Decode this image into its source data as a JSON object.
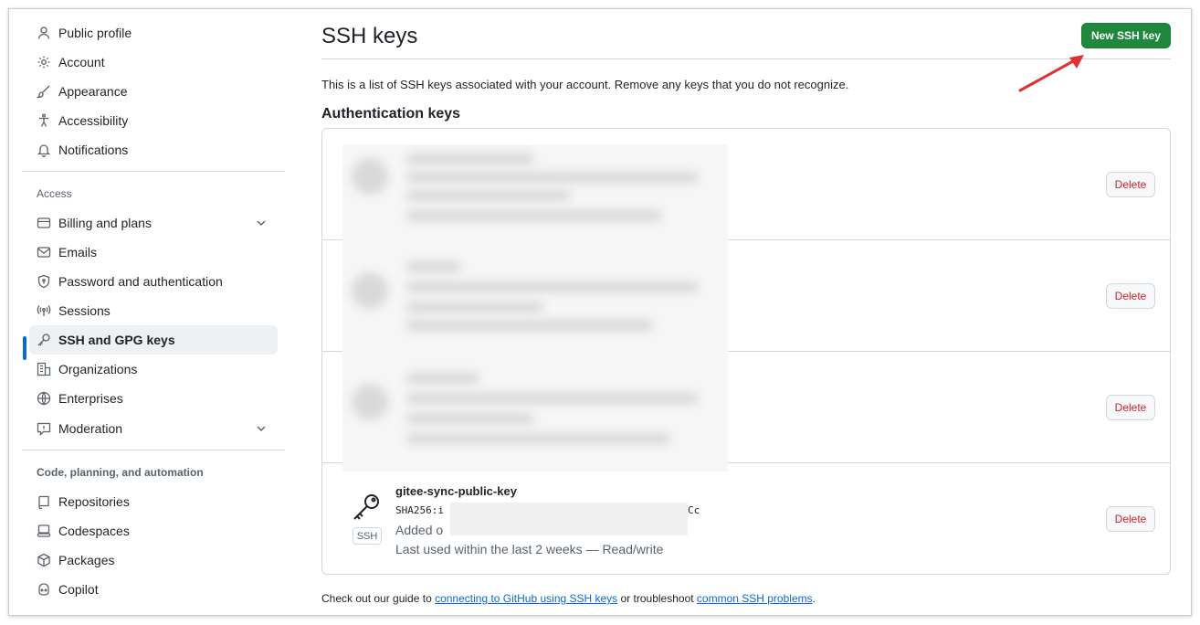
{
  "sidebar": {
    "top_items": [
      {
        "label": "Public profile",
        "icon": "person-icon"
      },
      {
        "label": "Account",
        "icon": "gear-icon"
      },
      {
        "label": "Appearance",
        "icon": "paintbrush-icon"
      },
      {
        "label": "Accessibility",
        "icon": "accessibility-icon"
      },
      {
        "label": "Notifications",
        "icon": "bell-icon"
      }
    ],
    "access_heading": "Access",
    "access_items": [
      {
        "label": "Billing and plans",
        "icon": "credit-card-icon",
        "expandable": true
      },
      {
        "label": "Emails",
        "icon": "mail-icon"
      },
      {
        "label": "Password and authentication",
        "icon": "shield-lock-icon"
      },
      {
        "label": "Sessions",
        "icon": "broadcast-icon"
      },
      {
        "label": "SSH and GPG keys",
        "icon": "key-icon",
        "active": true
      },
      {
        "label": "Organizations",
        "icon": "organization-icon"
      },
      {
        "label": "Enterprises",
        "icon": "globe-icon"
      },
      {
        "label": "Moderation",
        "icon": "report-icon",
        "expandable": true
      }
    ],
    "code_heading": "Code, planning, and automation",
    "code_items": [
      {
        "label": "Repositories",
        "icon": "repo-icon"
      },
      {
        "label": "Codespaces",
        "icon": "codespaces-icon"
      },
      {
        "label": "Packages",
        "icon": "package-icon"
      },
      {
        "label": "Copilot",
        "icon": "copilot-icon"
      }
    ]
  },
  "main": {
    "title": "SSH keys",
    "new_button": "New SSH key",
    "intro": "This is a list of SSH keys associated with your account. Remove any keys that you do not recognize.",
    "auth_heading": "Authentication keys",
    "delete_label": "Delete",
    "visible_key": {
      "name": "gitee-sync-public-key",
      "fingerprint_prefix": "SHA256:i",
      "fingerprint_suffix": "Cc",
      "added_prefix": "Added o",
      "last_used": "Last used within the last 2 weeks — Read/write",
      "badge": "SSH"
    },
    "footer": {
      "prefix": "Check out our guide to ",
      "link1": "connecting to GitHub using SSH keys",
      "middle": " or troubleshoot ",
      "link2": "common SSH problems",
      "suffix": "."
    }
  },
  "colors": {
    "accent": "#0969da",
    "primary_button": "#1f883d",
    "danger": "#d1242f",
    "annotation_arrow": "#e03131"
  }
}
